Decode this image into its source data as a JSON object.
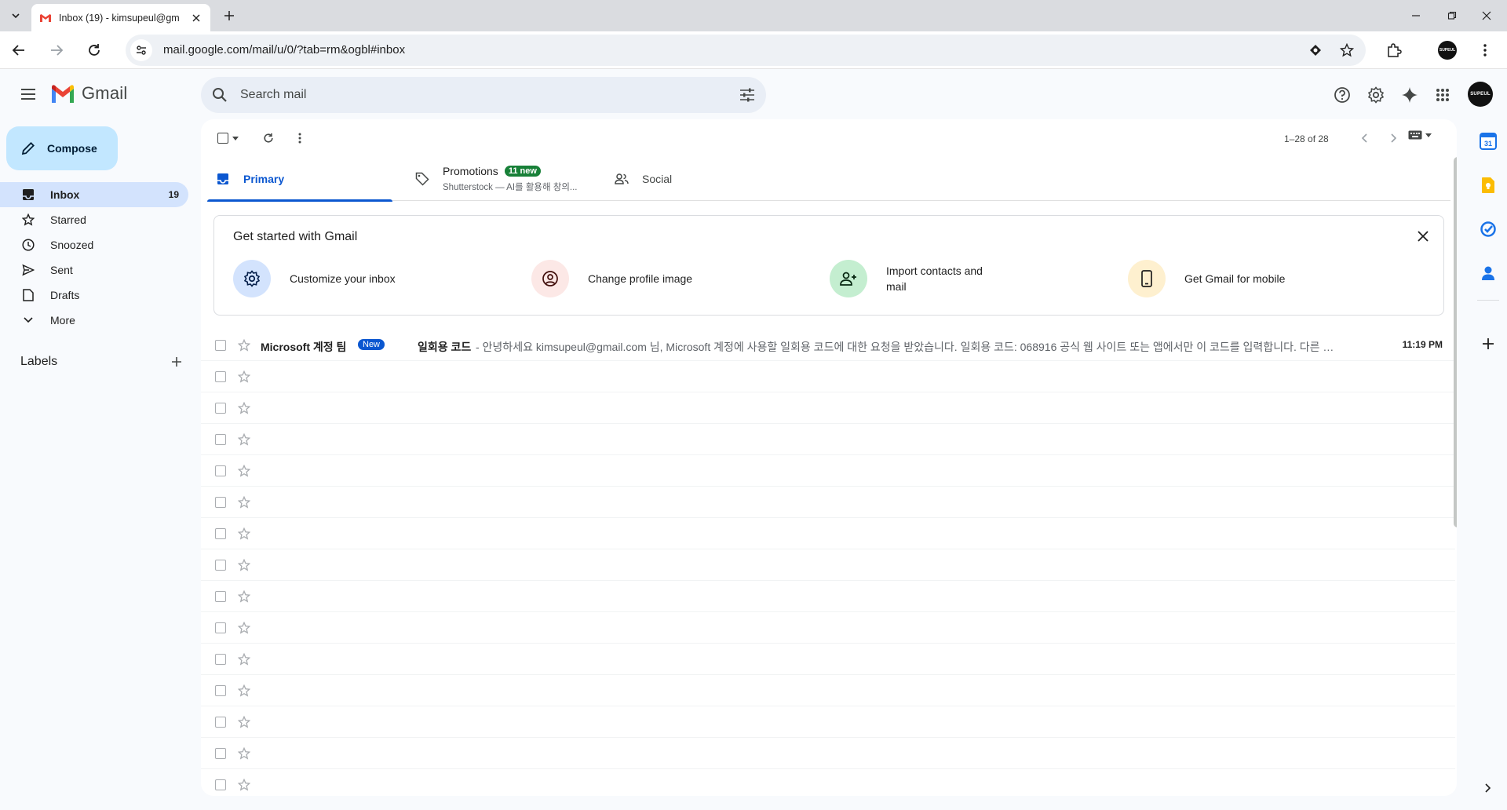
{
  "browser": {
    "tab_title": "Inbox (19) - kimsupeul@gm",
    "url": "mail.google.com/mail/u/0/?tab=rm&ogbl#inbox"
  },
  "app": {
    "name": "Gmail"
  },
  "search": {
    "placeholder": "Search mail"
  },
  "avatar_text": "SUPEUL",
  "compose_label": "Compose",
  "nav": [
    {
      "label": "Inbox",
      "count": "19"
    },
    {
      "label": "Starred"
    },
    {
      "label": "Snoozed"
    },
    {
      "label": "Sent"
    },
    {
      "label": "Drafts"
    },
    {
      "label": "More"
    }
  ],
  "labels_title": "Labels",
  "pagination": "1–28 of 28",
  "tabs": {
    "primary": "Primary",
    "promotions": "Promotions",
    "promotions_badge": "11 new",
    "promotions_snippet": "Shutterstock — AI를 활용해 창의...",
    "social": "Social"
  },
  "getstarted": {
    "title": "Get started with Gmail",
    "items": [
      {
        "label": "Customize your inbox"
      },
      {
        "label": "Change profile image"
      },
      {
        "label": "Import contacts and mail"
      },
      {
        "label": "Get Gmail for mobile"
      }
    ]
  },
  "emails": [
    {
      "sender": "Microsoft 계정 팀",
      "badge": "New",
      "subject": "일회용 코드",
      "snippet": "- 안녕하세요 kimsupeul@gmail.com 님, Microsoft 계정에 사용할 일회용 코드에 대한 요청을 받았습니다. 일회용 코드: 068916 공식 웹 사이트 또는 앱에서만 이 코드를 입력합니다. 다른 사용자...",
      "time": "11:19 PM"
    }
  ],
  "colors": {
    "accent": "#0b57d0",
    "compose_bg": "#c2e7ff",
    "active_nav": "#d3e3fd",
    "promo_badge": "#188038"
  }
}
